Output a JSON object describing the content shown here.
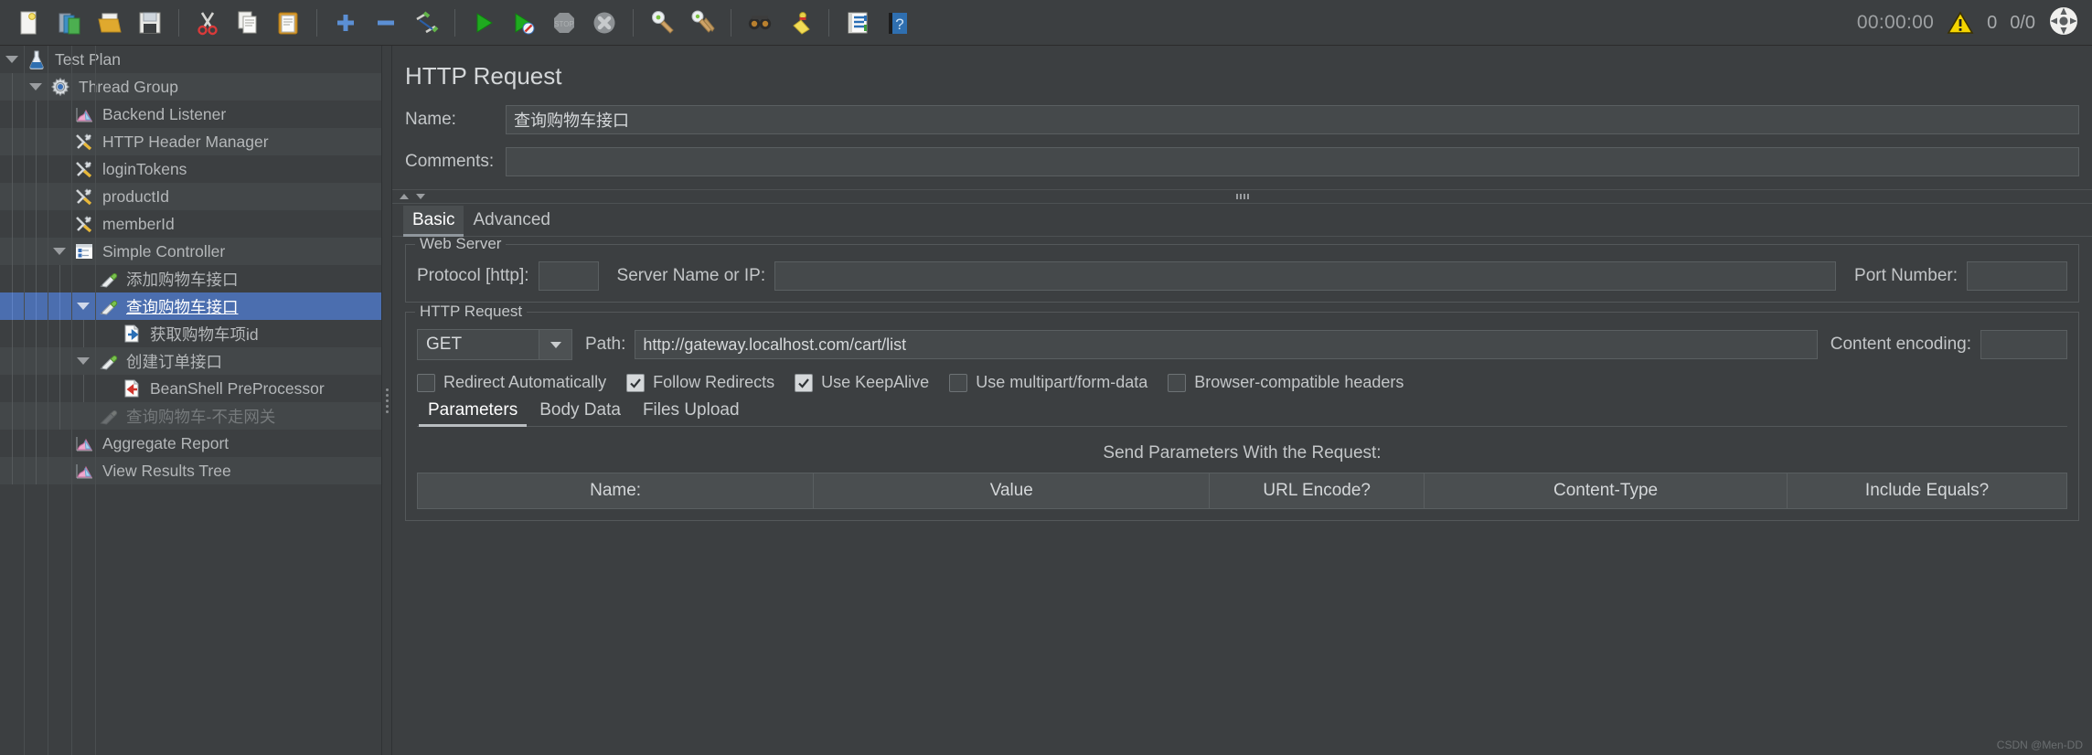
{
  "toolbar": {
    "icons": [
      {
        "name": "new-icon",
        "label": "New"
      },
      {
        "name": "templates-icon",
        "label": "Templates"
      },
      {
        "name": "open-icon",
        "label": "Open"
      },
      {
        "name": "save-icon",
        "label": "Save Test Plan"
      },
      {
        "name": "cut-icon",
        "label": "Cut"
      },
      {
        "name": "copy-icon",
        "label": "Copy"
      },
      {
        "name": "paste-icon",
        "label": "Paste"
      },
      {
        "name": "expand-all-icon",
        "label": "Expand All"
      },
      {
        "name": "collapse-all-icon",
        "label": "Collapse All"
      },
      {
        "name": "toggle-icon",
        "label": "Toggle"
      },
      {
        "name": "start-icon",
        "label": "Start"
      },
      {
        "name": "start-no-pauses-icon",
        "label": "Start no pauses"
      },
      {
        "name": "stop-icon",
        "label": "Stop"
      },
      {
        "name": "shutdown-icon",
        "label": "Shutdown"
      },
      {
        "name": "clear-icon",
        "label": "Clear"
      },
      {
        "name": "clear-all-icon",
        "label": "Clear All"
      },
      {
        "name": "search-icon",
        "label": "Search"
      },
      {
        "name": "reset-search-icon",
        "label": "Reset Search"
      },
      {
        "name": "function-helper-icon",
        "label": "Function Helper Dialog"
      },
      {
        "name": "help-icon",
        "label": "Help"
      }
    ],
    "timer": "00:00:00",
    "warning_count": "0",
    "thread_counts": "0/0"
  },
  "tree": {
    "items": [
      {
        "label": "Test Plan",
        "depth": 0,
        "icon": "test-plan-icon",
        "expander": "open",
        "selected": false,
        "disabled": false
      },
      {
        "label": "Thread Group",
        "depth": 1,
        "icon": "thread-group-icon",
        "expander": "open",
        "selected": false,
        "disabled": false
      },
      {
        "label": "Backend Listener",
        "depth": 2,
        "icon": "listener-icon",
        "expander": "none",
        "selected": false,
        "disabled": false
      },
      {
        "label": "HTTP Header Manager",
        "depth": 2,
        "icon": "config-element-icon",
        "expander": "none",
        "selected": false,
        "disabled": false
      },
      {
        "label": "loginTokens",
        "depth": 2,
        "icon": "config-element-icon",
        "expander": "none",
        "selected": false,
        "disabled": false
      },
      {
        "label": "productId",
        "depth": 2,
        "icon": "config-element-icon",
        "expander": "none",
        "selected": false,
        "disabled": false
      },
      {
        "label": "memberId",
        "depth": 2,
        "icon": "config-element-icon",
        "expander": "none",
        "selected": false,
        "disabled": false
      },
      {
        "label": "Simple Controller",
        "depth": 2,
        "icon": "controller-icon",
        "expander": "open",
        "selected": false,
        "disabled": false
      },
      {
        "label": "添加购物车接口",
        "depth": 3,
        "icon": "http-sampler-icon",
        "expander": "none",
        "selected": false,
        "disabled": false
      },
      {
        "label": "查询购物车接口",
        "depth": 3,
        "icon": "http-sampler-icon",
        "expander": "open",
        "selected": true,
        "disabled": false
      },
      {
        "label": "获取购物车项id",
        "depth": 4,
        "icon": "post-processor-icon",
        "expander": "none",
        "selected": false,
        "disabled": false
      },
      {
        "label": "创建订单接口",
        "depth": 3,
        "icon": "http-sampler-icon",
        "expander": "open",
        "selected": false,
        "disabled": false
      },
      {
        "label": "BeanShell PreProcessor",
        "depth": 4,
        "icon": "pre-processor-icon",
        "expander": "none",
        "selected": false,
        "disabled": false
      },
      {
        "label": "查询购物车-不走网关",
        "depth": 3,
        "icon": "http-sampler-disabled-icon",
        "expander": "none",
        "selected": false,
        "disabled": true
      },
      {
        "label": "Aggregate Report",
        "depth": 2,
        "icon": "listener-icon",
        "expander": "none",
        "selected": false,
        "disabled": false
      },
      {
        "label": "View Results Tree",
        "depth": 2,
        "icon": "listener-icon",
        "expander": "none",
        "selected": false,
        "disabled": false
      }
    ]
  },
  "panel": {
    "title": "HTTP Request",
    "name_label": "Name:",
    "name_value": "查询购物车接口",
    "comments_label": "Comments:",
    "comments_value": "",
    "tabs": [
      {
        "label": "Basic",
        "active": true
      },
      {
        "label": "Advanced",
        "active": false
      }
    ],
    "web_server": {
      "legend": "Web Server",
      "protocol_label": "Protocol [http]:",
      "protocol_value": "",
      "server_label": "Server Name or IP:",
      "server_value": "",
      "port_label": "Port Number:",
      "port_value": ""
    },
    "http_request": {
      "legend": "HTTP Request",
      "method": "GET",
      "path_label": "Path:",
      "path_value": "http://gateway.localhost.com/cart/list",
      "content_encoding_label": "Content encoding:",
      "content_encoding_value": "",
      "checkboxes": [
        {
          "label": "Redirect Automatically",
          "checked": false
        },
        {
          "label": "Follow Redirects",
          "checked": true
        },
        {
          "label": "Use KeepAlive",
          "checked": true
        },
        {
          "label": "Use multipart/form-data",
          "checked": false
        },
        {
          "label": "Browser-compatible headers",
          "checked": false
        }
      ],
      "subtabs": [
        {
          "label": "Parameters",
          "active": true
        },
        {
          "label": "Body Data",
          "active": false
        },
        {
          "label": "Files Upload",
          "active": false
        }
      ],
      "send_params_title": "Send Parameters With the Request:",
      "table_headers": [
        "Name:",
        "Value",
        "URL Encode?",
        "Content-Type",
        "Include Equals?"
      ]
    }
  },
  "watermark": "CSDN @Men-DD"
}
